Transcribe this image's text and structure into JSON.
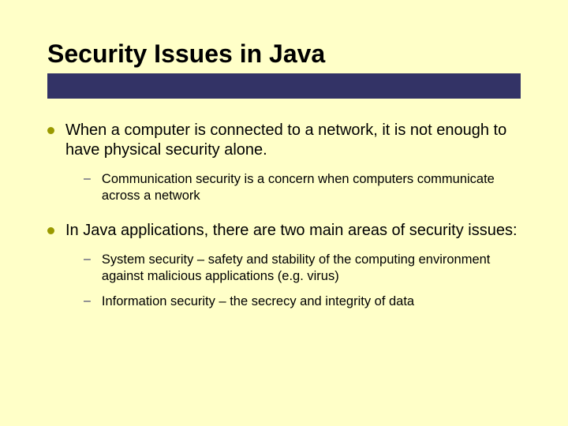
{
  "slide": {
    "title": "Security Issues in Java",
    "items": [
      {
        "text": "When a computer is connected to a network, it is not enough to have physical security alone.",
        "sub": [
          "Communication security is a concern when computers communicate across a network"
        ]
      },
      {
        "text": "In Java applications, there are two main areas of security issues:",
        "sub": [
          "System security – safety and stability of the computing environment against malicious applications (e.g. virus)",
          "Information security – the secrecy and integrity of data"
        ]
      }
    ]
  }
}
